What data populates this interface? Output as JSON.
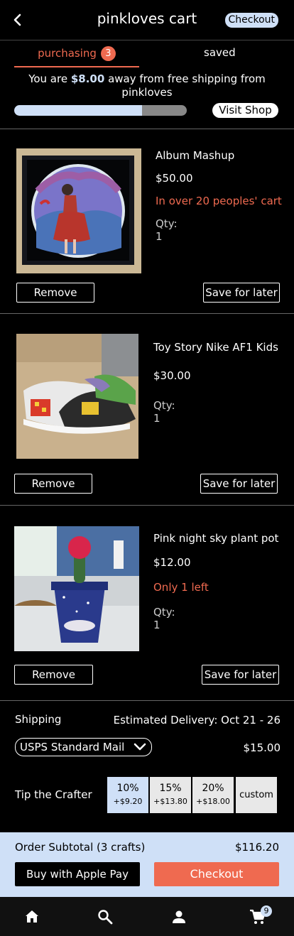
{
  "header": {
    "title": "pinkloves cart",
    "checkout_label": "Checkout"
  },
  "tabs": {
    "purchasing_label": "purchasing",
    "purchasing_count": "3",
    "saved_label": "saved"
  },
  "shipping_banner": {
    "prefix": "You are ",
    "amount": "$8.00",
    "suffix": " away from free shipping from pinkloves",
    "progress": 0.74,
    "visit_label": "Visit Shop"
  },
  "items": [
    {
      "name": "Album Mashup",
      "price": "$50.00",
      "note": "In over 20 peoples' cart",
      "qty": "Qty: 1",
      "remove_label": "Remove",
      "save_label": "Save for later"
    },
    {
      "name": "Toy Story Nike AF1 Kids",
      "price": "$30.00",
      "note": "",
      "qty": "Qty: 1",
      "remove_label": "Remove",
      "save_label": "Save for later"
    },
    {
      "name": "Pink night sky plant pot",
      "price": "$12.00",
      "note": "Only 1 left",
      "qty": "Qty: 1",
      "remove_label": "Remove",
      "save_label": "Save for later"
    }
  ],
  "shipping": {
    "label": "Shipping",
    "estimate": "Estimated Delivery: Oct 21 - 26",
    "method": "USPS Standard Mail",
    "cost": "$15.00"
  },
  "tip": {
    "label": "Tip the Crafter",
    "options": [
      {
        "pct": "10%",
        "amt": "+$9.20"
      },
      {
        "pct": "15%",
        "amt": "+$13.80"
      },
      {
        "pct": "20%",
        "amt": "+$18.00"
      }
    ],
    "custom_label": "custom"
  },
  "footer": {
    "subtotal_label": "Order Subtotal (3 crafts)",
    "subtotal_value": "$116.20",
    "apple_pay_label": "Buy with Apple Pay",
    "checkout_label": "Checkout"
  },
  "nav": {
    "icons": [
      "home-icon",
      "search-icon",
      "profile-icon",
      "cart-icon"
    ],
    "cart_count": "9"
  },
  "colors": {
    "accent": "#ef6a50",
    "light_blue": "#cfe0f7",
    "background": "#000000"
  }
}
